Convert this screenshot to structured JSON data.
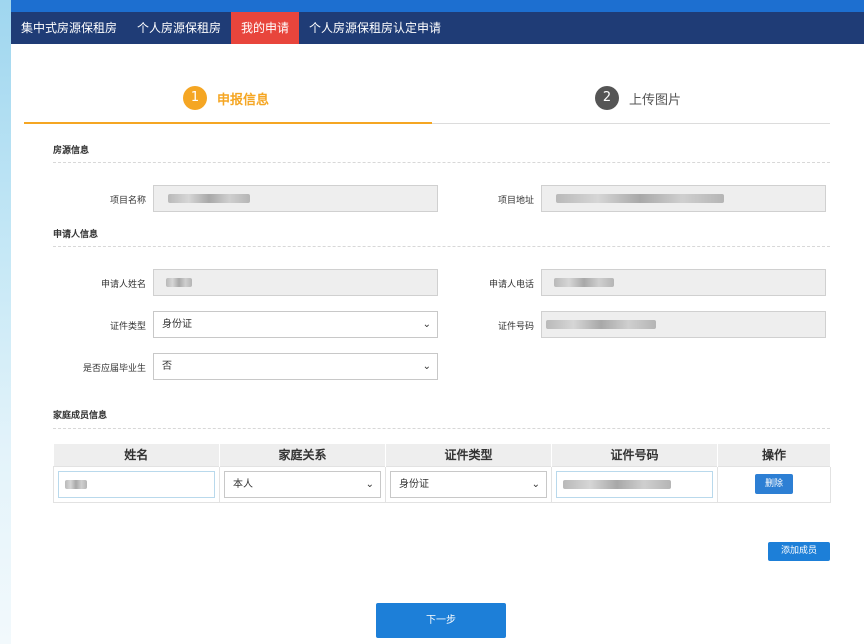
{
  "nav": {
    "items": [
      {
        "label": "集中式房源保租房",
        "active": false
      },
      {
        "label": "个人房源保租房",
        "active": false
      },
      {
        "label": "我的申请",
        "active": true
      },
      {
        "label": "个人房源保租房认定申请",
        "active": false
      }
    ]
  },
  "steps": [
    {
      "number": "1",
      "label": "申报信息",
      "active": true
    },
    {
      "number": "2",
      "label": "上传图片",
      "active": false
    }
  ],
  "house_section": {
    "title": "房源信息",
    "project_name_label": "项目名称",
    "project_address_label": "项目地址"
  },
  "applicant_section": {
    "title": "申请人信息",
    "name_label": "申请人姓名",
    "phone_label": "申请人电话",
    "id_type_label": "证件类型",
    "id_type_value": "身份证",
    "id_number_label": "证件号码",
    "graduate_label": "是否应届毕业生",
    "graduate_value": "否"
  },
  "family_section": {
    "title": "家庭成员信息",
    "columns": [
      "姓名",
      "家庭关系",
      "证件类型",
      "证件号码",
      "操作"
    ],
    "rows": [
      {
        "relation": "本人",
        "id_type": "身份证",
        "action_label": "删除"
      }
    ],
    "add_label": "添加成员"
  },
  "next_label": "下一步",
  "colors": {
    "nav_bg": "#1f3c76",
    "nav_active": "#e8453c",
    "step_active": "#f5a623",
    "primary_button": "#1d7fd8"
  }
}
